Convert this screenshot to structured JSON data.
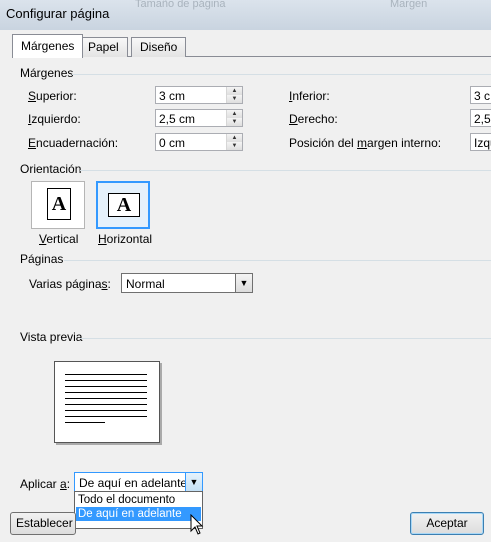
{
  "window": {
    "title": "Configurar página",
    "ghost_tabs": [
      "Tamaño de página",
      "Margen"
    ]
  },
  "tabs": [
    {
      "label": "Márgenes",
      "active": true
    },
    {
      "label": "Papel",
      "active": false
    },
    {
      "label": "Diseño",
      "active": false
    }
  ],
  "margins": {
    "group_label": "Márgenes",
    "top": {
      "label_u": "S",
      "label_rest": "uperior:",
      "value": "3 cm"
    },
    "left": {
      "label_u": "I",
      "label_rest": "zquierdo:",
      "value": "2,5 cm"
    },
    "gutter": {
      "label_u": "E",
      "label_rest": "ncuadernación:",
      "value": "0 cm"
    },
    "bottom": {
      "label_u": "I",
      "label_rest": "nferior:",
      "value": "3 c"
    },
    "right": {
      "label_u": "D",
      "label_rest": "erecho:",
      "value": "2,5"
    },
    "gutter_pos": {
      "label_pre": "Posición del ",
      "label_u": "m",
      "label_rest": "argen interno:",
      "value": "Izqu"
    }
  },
  "orientation": {
    "group_label": "Orientación",
    "glyph": "A",
    "vertical": {
      "label_u": "V",
      "label_rest": "ertical"
    },
    "horizontal": {
      "label_u": "H",
      "label_rest": "orizontal",
      "selected": true
    }
  },
  "pages": {
    "group_label": "Páginas",
    "multiple_label_pre": "Varias página",
    "multiple_label_u": "s",
    "multiple_label_post": ":",
    "multiple_value": "Normal"
  },
  "preview": {
    "group_label": "Vista previa"
  },
  "apply": {
    "label_pre": "Aplicar ",
    "label_u": "a",
    "label_post": ":",
    "value": "De aquí en adelante",
    "options": [
      "Todo el documento",
      "De aquí en adelante"
    ],
    "highlighted_index": 1
  },
  "buttons": {
    "default_label": "Establecer c",
    "ok_label": "Aceptar"
  },
  "icons": {
    "dropdown": "chevron-down-icon",
    "spin_up": "arrow-up-icon",
    "spin_down": "arrow-down-icon",
    "cursor": "mouse-pointer-icon"
  },
  "colors": {
    "accent": "#3399ff",
    "titlebar": "#c9d4e0"
  }
}
